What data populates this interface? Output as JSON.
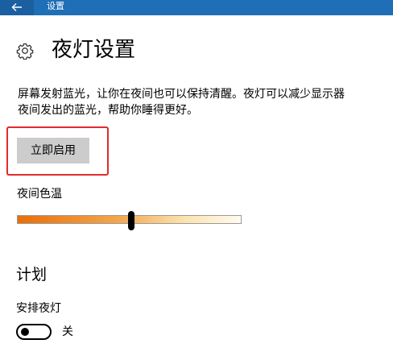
{
  "window": {
    "title": "设置",
    "back_icon": "back-arrow-icon",
    "title_bar_color": "#1f6fb7"
  },
  "header": {
    "icon": "gear-icon",
    "title": "夜灯设置"
  },
  "description": {
    "line1": "屏幕发射蓝光，让你在夜间也可以保持清醒。夜灯可以减少显示器",
    "line2": "夜间发出的蓝光，帮助你睡得更好。"
  },
  "enable_button": {
    "label": "立即启用",
    "highlight_color": "#e32b2b"
  },
  "color_temperature": {
    "label": "夜间色温",
    "slider_value_fraction": 0.51,
    "gradient_colors": [
      "#e86f0a",
      "#f3a64d",
      "#fbe3b0",
      "#fffaf0"
    ]
  },
  "schedule": {
    "heading": "计划",
    "toggle_label": "安排夜灯",
    "toggle_state_text": "关",
    "toggle_on": false
  }
}
